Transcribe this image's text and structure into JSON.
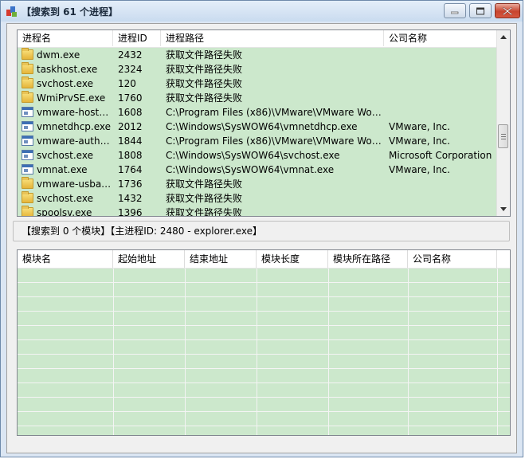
{
  "window": {
    "title": "【搜索到 61 个进程】",
    "controls": [
      "minimize",
      "maximize",
      "close"
    ]
  },
  "process_list": {
    "columns": [
      "进程名",
      "进程ID",
      "进程路径",
      "公司名称"
    ],
    "rows": [
      {
        "icon": "folder-icon",
        "name": "dwm.exe",
        "pid": "2432",
        "path": "获取文件路径失败",
        "company": ""
      },
      {
        "icon": "folder-icon",
        "name": "taskhost.exe",
        "pid": "2324",
        "path": "获取文件路径失败",
        "company": ""
      },
      {
        "icon": "folder-icon",
        "name": "svchost.exe",
        "pid": "120",
        "path": "获取文件路径失败",
        "company": ""
      },
      {
        "icon": "folder-icon",
        "name": "WmiPrvSE.exe",
        "pid": "1760",
        "path": "获取文件路径失败",
        "company": ""
      },
      {
        "icon": "exe-icon",
        "name": "vmware-hostd....",
        "pid": "1608",
        "path": "C:\\Program Files (x86)\\VMware\\VMware Work...",
        "company": ""
      },
      {
        "icon": "exe-icon",
        "name": "vmnetdhcp.exe",
        "pid": "2012",
        "path": "C:\\Windows\\SysWOW64\\vmnetdhcp.exe",
        "company": "VMware, Inc."
      },
      {
        "icon": "exe-icon",
        "name": "vmware-authd....",
        "pid": "1844",
        "path": "C:\\Program Files (x86)\\VMware\\VMware Work...",
        "company": "VMware, Inc."
      },
      {
        "icon": "exe-icon",
        "name": "svchost.exe",
        "pid": "1808",
        "path": "C:\\Windows\\SysWOW64\\svchost.exe",
        "company": "Microsoft Corporation"
      },
      {
        "icon": "exe-icon",
        "name": "vmnat.exe",
        "pid": "1764",
        "path": "C:\\Windows\\SysWOW64\\vmnat.exe",
        "company": "VMware, Inc."
      },
      {
        "icon": "folder-icon",
        "name": "vmware-usbarb...",
        "pid": "1736",
        "path": "获取文件路径失败",
        "company": ""
      },
      {
        "icon": "folder-icon",
        "name": "svchost.exe",
        "pid": "1432",
        "path": "获取文件路径失败",
        "company": ""
      },
      {
        "icon": "folder-icon",
        "name": "spoolsv.exe",
        "pid": "1396",
        "path": "获取文件路径失败",
        "company": ""
      }
    ]
  },
  "status": {
    "text": "【搜索到 0 个模块】【主进程ID: 2480 - explorer.exe】"
  },
  "module_list": {
    "columns": [
      "模块名",
      "起始地址",
      "结束地址",
      "模块长度",
      "模块所在路径",
      "公司名称"
    ]
  }
}
